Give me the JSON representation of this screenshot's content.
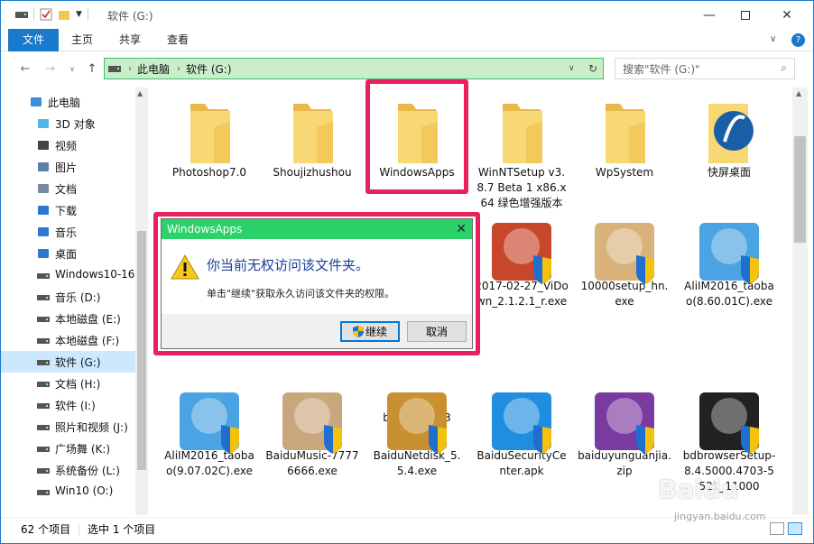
{
  "window": {
    "title": "软件 (G:)"
  },
  "ribbon": {
    "tabs": [
      "文件",
      "主页",
      "共享",
      "查看"
    ]
  },
  "address": {
    "crumbs": [
      "此电脑",
      "软件 (G:)"
    ],
    "search_placeholder": "搜索\"软件 (G:)\""
  },
  "sidebar": {
    "items": [
      {
        "label": "此电脑",
        "icon": "computer-icon"
      },
      {
        "label": "3D 对象",
        "icon": "3d-objects-icon"
      },
      {
        "label": "视频",
        "icon": "video-icon"
      },
      {
        "label": "图片",
        "icon": "pictures-icon"
      },
      {
        "label": "文档",
        "icon": "documents-icon"
      },
      {
        "label": "下载",
        "icon": "download-icon"
      },
      {
        "label": "音乐",
        "icon": "music-icon"
      },
      {
        "label": "桌面",
        "icon": "desktop-icon"
      },
      {
        "label": "Windows10-16",
        "icon": "drive-icon"
      },
      {
        "label": "音乐 (D:)",
        "icon": "drive-icon"
      },
      {
        "label": "本地磁盘 (E:)",
        "icon": "drive-icon"
      },
      {
        "label": "本地磁盘 (F:)",
        "icon": "drive-icon"
      },
      {
        "label": "软件 (G:)",
        "icon": "drive-icon"
      },
      {
        "label": "文档 (H:)",
        "icon": "drive-icon"
      },
      {
        "label": "软件 (I:)",
        "icon": "drive-icon"
      },
      {
        "label": "照片和视频 (J:)",
        "icon": "drive-icon"
      },
      {
        "label": "广场舞 (K:)",
        "icon": "drive-icon"
      },
      {
        "label": "系统备份 (L:)",
        "icon": "drive-icon"
      },
      {
        "label": "Win10 (O:)",
        "icon": "drive-icon"
      }
    ]
  },
  "files": [
    {
      "label": "Photoshop7.0",
      "icon": "folder-icon"
    },
    {
      "label": "Shoujizhushou",
      "icon": "folder-icon"
    },
    {
      "label": "WindowsApps",
      "icon": "folder-icon"
    },
    {
      "label": "WinNTSetup v3.8.7 Beta 1 x86.x64 绿色增强版本",
      "icon": "folder-icon"
    },
    {
      "label": "WpSystem",
      "icon": "folder-icon"
    },
    {
      "label": "快屏桌面",
      "icon": "folder-icon"
    },
    {
      "label": "b514cb.mp3",
      "icon": "audio-file-icon"
    },
    {
      "label": "2017-02-27_ViDown_2.1.2.1_r.exe",
      "icon": "installer-icon"
    },
    {
      "label": "10000setup_hn.exe",
      "icon": "setup-box-icon"
    },
    {
      "label": "AliIM2016_taobao(8.60.01C).exe",
      "icon": "aliwangwang-icon"
    },
    {
      "label": "AliIM2016_taobao(9.07.02C).exe",
      "icon": "aliwangwang-icon"
    },
    {
      "label": "BaiduMusic-77776666.exe",
      "icon": "baidu-music-icon"
    },
    {
      "label": "BaiduNetdisk_5.5.4.exe",
      "icon": "baidu-netdisk-icon"
    },
    {
      "label": "BaiduSecurityCenter.apk",
      "icon": "ie-icon"
    },
    {
      "label": "baiduyunguanjia.zip",
      "icon": "winrar-icon"
    },
    {
      "label": "bdbrowserSetup-8.4.5000.4703-5521_11000",
      "icon": "bdbrowser-icon"
    }
  ],
  "dialog": {
    "title": "WindowsApps",
    "heading": "你当前无权访问该文件夹。",
    "message": "单击\"继续\"获取永久访问该文件夹的权限。",
    "continue_label": "继续",
    "cancel_label": "取消"
  },
  "status": {
    "count": "62 个项目",
    "selected": "选中 1 个项目"
  },
  "watermark": {
    "logo": "Baidu",
    "url": "jingyan.baidu.com"
  },
  "colors": {
    "accent": "#1979ca",
    "dialog_title": "#2dd169",
    "highlight": "#e8215c",
    "address_bg": "#c9eec9"
  }
}
